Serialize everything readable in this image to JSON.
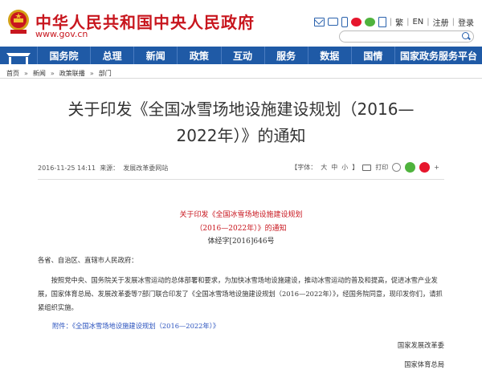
{
  "header": {
    "site_title": "中华人民共和国中央人民政府",
    "site_domain": "www.gov.cn",
    "links": [
      "繁",
      "EN",
      "注册",
      "登录"
    ],
    "icons": [
      "mail-icon",
      "tv-icon",
      "phone-icon",
      "weibo-icon",
      "wechat-icon",
      "app-icon"
    ]
  },
  "nav": {
    "items": [
      "国务院",
      "总理",
      "新闻",
      "政策",
      "互动",
      "服务",
      "数据",
      "国情",
      "国家政务服务平台"
    ],
    "bg_color": "#1f5aa6"
  },
  "breadcrumb": [
    "首页",
    "新闻",
    "政策联播",
    "部门"
  ],
  "article": {
    "title": "关于印发《全国冰雪场地设施建设规划（2016—2022年）》的通知",
    "date": "2016-11-25 14:11",
    "source_label": "来源：",
    "source": "发展改革委网站",
    "font_size_label": "【字体：",
    "font_large": "大",
    "font_medium": "中",
    "font_small": "小",
    "font_close": "】",
    "print_label": "打印",
    "doc_title_line1": "关于印发《全国冰雪场地设施建设规划",
    "doc_title_line2": "（2016—2022年）》的通知",
    "doc_number": "体经字[2016]646号",
    "salutation": "各省、自治区、直辖市人民政府：",
    "paragraph": "按照党中央、国务院关于发展冰雪运动的总体部署和要求，为加快冰雪场地设施建设，推动冰雪运动的普及和提高，促进冰雪产业发展，国家体育总局、发展改革委等7部门联合印发了《全国冰雪场地设施建设规划（2016—2022年）》，经国务院同意，现印发你们，请抓紧组织实施。",
    "attachment": "附件：《全国冰雪场地设施建设规划（2016—2022年）》",
    "signer1": "国家发展改革委",
    "signer2": "国家体育总局"
  },
  "colors": {
    "brand_red": "#c8161e",
    "link_blue": "#2a52be"
  }
}
